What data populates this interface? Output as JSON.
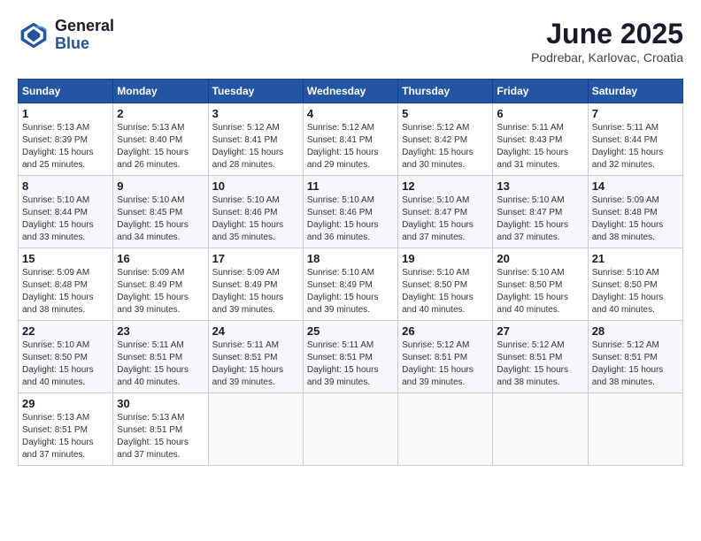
{
  "logo": {
    "general": "General",
    "blue": "Blue"
  },
  "header": {
    "title": "June 2025",
    "subtitle": "Podrebar, Karlovac, Croatia"
  },
  "weekdays": [
    "Sunday",
    "Monday",
    "Tuesday",
    "Wednesday",
    "Thursday",
    "Friday",
    "Saturday"
  ],
  "weeks": [
    [
      {
        "day": "1",
        "info": "Sunrise: 5:13 AM\nSunset: 8:39 PM\nDaylight: 15 hours\nand 25 minutes."
      },
      {
        "day": "2",
        "info": "Sunrise: 5:13 AM\nSunset: 8:40 PM\nDaylight: 15 hours\nand 26 minutes."
      },
      {
        "day": "3",
        "info": "Sunrise: 5:12 AM\nSunset: 8:41 PM\nDaylight: 15 hours\nand 28 minutes."
      },
      {
        "day": "4",
        "info": "Sunrise: 5:12 AM\nSunset: 8:41 PM\nDaylight: 15 hours\nand 29 minutes."
      },
      {
        "day": "5",
        "info": "Sunrise: 5:12 AM\nSunset: 8:42 PM\nDaylight: 15 hours\nand 30 minutes."
      },
      {
        "day": "6",
        "info": "Sunrise: 5:11 AM\nSunset: 8:43 PM\nDaylight: 15 hours\nand 31 minutes."
      },
      {
        "day": "7",
        "info": "Sunrise: 5:11 AM\nSunset: 8:44 PM\nDaylight: 15 hours\nand 32 minutes."
      }
    ],
    [
      {
        "day": "8",
        "info": "Sunrise: 5:10 AM\nSunset: 8:44 PM\nDaylight: 15 hours\nand 33 minutes."
      },
      {
        "day": "9",
        "info": "Sunrise: 5:10 AM\nSunset: 8:45 PM\nDaylight: 15 hours\nand 34 minutes."
      },
      {
        "day": "10",
        "info": "Sunrise: 5:10 AM\nSunset: 8:46 PM\nDaylight: 15 hours\nand 35 minutes."
      },
      {
        "day": "11",
        "info": "Sunrise: 5:10 AM\nSunset: 8:46 PM\nDaylight: 15 hours\nand 36 minutes."
      },
      {
        "day": "12",
        "info": "Sunrise: 5:10 AM\nSunset: 8:47 PM\nDaylight: 15 hours\nand 37 minutes."
      },
      {
        "day": "13",
        "info": "Sunrise: 5:10 AM\nSunset: 8:47 PM\nDaylight: 15 hours\nand 37 minutes."
      },
      {
        "day": "14",
        "info": "Sunrise: 5:09 AM\nSunset: 8:48 PM\nDaylight: 15 hours\nand 38 minutes."
      }
    ],
    [
      {
        "day": "15",
        "info": "Sunrise: 5:09 AM\nSunset: 8:48 PM\nDaylight: 15 hours\nand 38 minutes."
      },
      {
        "day": "16",
        "info": "Sunrise: 5:09 AM\nSunset: 8:49 PM\nDaylight: 15 hours\nand 39 minutes."
      },
      {
        "day": "17",
        "info": "Sunrise: 5:09 AM\nSunset: 8:49 PM\nDaylight: 15 hours\nand 39 minutes."
      },
      {
        "day": "18",
        "info": "Sunrise: 5:10 AM\nSunset: 8:49 PM\nDaylight: 15 hours\nand 39 minutes."
      },
      {
        "day": "19",
        "info": "Sunrise: 5:10 AM\nSunset: 8:50 PM\nDaylight: 15 hours\nand 40 minutes."
      },
      {
        "day": "20",
        "info": "Sunrise: 5:10 AM\nSunset: 8:50 PM\nDaylight: 15 hours\nand 40 minutes."
      },
      {
        "day": "21",
        "info": "Sunrise: 5:10 AM\nSunset: 8:50 PM\nDaylight: 15 hours\nand 40 minutes."
      }
    ],
    [
      {
        "day": "22",
        "info": "Sunrise: 5:10 AM\nSunset: 8:50 PM\nDaylight: 15 hours\nand 40 minutes."
      },
      {
        "day": "23",
        "info": "Sunrise: 5:11 AM\nSunset: 8:51 PM\nDaylight: 15 hours\nand 40 minutes."
      },
      {
        "day": "24",
        "info": "Sunrise: 5:11 AM\nSunset: 8:51 PM\nDaylight: 15 hours\nand 39 minutes."
      },
      {
        "day": "25",
        "info": "Sunrise: 5:11 AM\nSunset: 8:51 PM\nDaylight: 15 hours\nand 39 minutes."
      },
      {
        "day": "26",
        "info": "Sunrise: 5:12 AM\nSunset: 8:51 PM\nDaylight: 15 hours\nand 39 minutes."
      },
      {
        "day": "27",
        "info": "Sunrise: 5:12 AM\nSunset: 8:51 PM\nDaylight: 15 hours\nand 38 minutes."
      },
      {
        "day": "28",
        "info": "Sunrise: 5:12 AM\nSunset: 8:51 PM\nDaylight: 15 hours\nand 38 minutes."
      }
    ],
    [
      {
        "day": "29",
        "info": "Sunrise: 5:13 AM\nSunset: 8:51 PM\nDaylight: 15 hours\nand 37 minutes."
      },
      {
        "day": "30",
        "info": "Sunrise: 5:13 AM\nSunset: 8:51 PM\nDaylight: 15 hours\nand 37 minutes."
      },
      {
        "day": "",
        "info": ""
      },
      {
        "day": "",
        "info": ""
      },
      {
        "day": "",
        "info": ""
      },
      {
        "day": "",
        "info": ""
      },
      {
        "day": "",
        "info": ""
      }
    ]
  ]
}
